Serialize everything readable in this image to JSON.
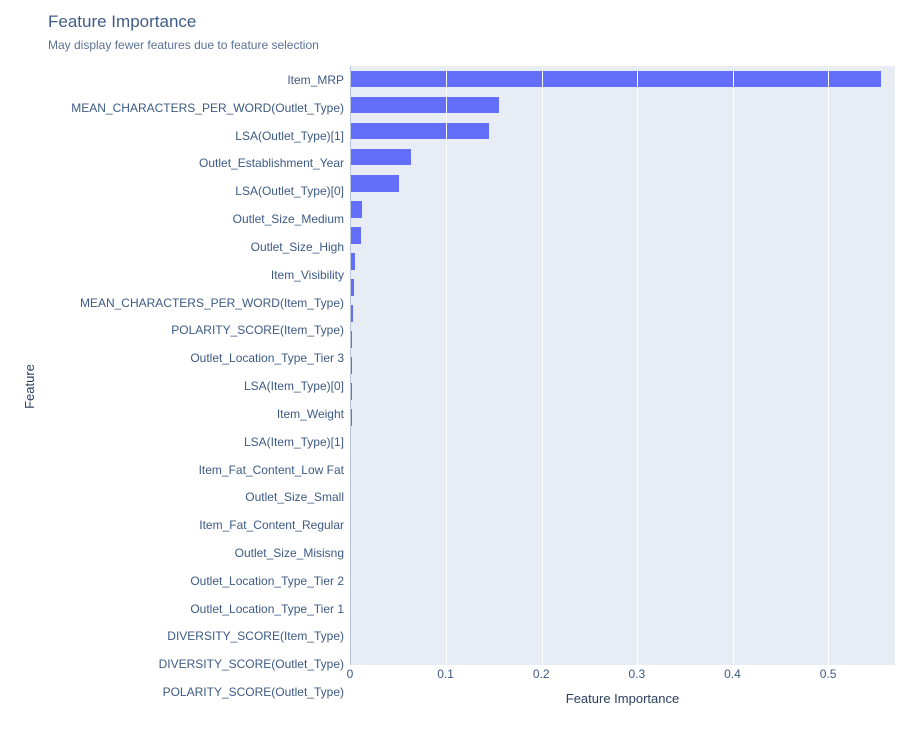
{
  "title": "Feature Importance",
  "subtitle": "May display fewer features due to feature selection",
  "y_axis_label": "Feature",
  "x_axis_label": "Feature Importance",
  "chart_data": {
    "type": "bar",
    "orientation": "horizontal",
    "xlim": [
      0,
      0.57
    ],
    "xticks": [
      0,
      0.1,
      0.2,
      0.3,
      0.4,
      0.5
    ],
    "xtick_labels": [
      "0",
      "0.1",
      "0.2",
      "0.3",
      "0.4",
      "0.5"
    ],
    "ylabel": "Feature",
    "xlabel": "Feature Importance",
    "title": "Feature Importance",
    "categories": [
      "Item_MRP",
      "MEAN_CHARACTERS_PER_WORD(Outlet_Type)",
      "LSA(Outlet_Type)[1]",
      "Outlet_Establishment_Year",
      "LSA(Outlet_Type)[0]",
      "Outlet_Size_Medium",
      "Outlet_Size_High",
      "Item_Visibility",
      "MEAN_CHARACTERS_PER_WORD(Item_Type)",
      "POLARITY_SCORE(Item_Type)",
      "Outlet_Location_Type_Tier 3",
      "LSA(Item_Type)[0]",
      "Item_Weight",
      "LSA(Item_Type)[1]",
      "Item_Fat_Content_Low Fat",
      "Outlet_Size_Small",
      "Item_Fat_Content_Regular",
      "Outlet_Size_Misisng",
      "Outlet_Location_Type_Tier 2",
      "Outlet_Location_Type_Tier 1",
      "DIVERSITY_SCORE(Item_Type)",
      "DIVERSITY_SCORE(Outlet_Type)",
      "POLARITY_SCORE(Outlet_Type)"
    ],
    "values": [
      0.555,
      0.155,
      0.145,
      0.063,
      0.05,
      0.012,
      0.01,
      0.004,
      0.003,
      0.002,
      0.001,
      0.001,
      0.001,
      0.001,
      0.0,
      0.0,
      0.0,
      0.0,
      0.0,
      0.0,
      0.0,
      0.0,
      0.0
    ]
  }
}
